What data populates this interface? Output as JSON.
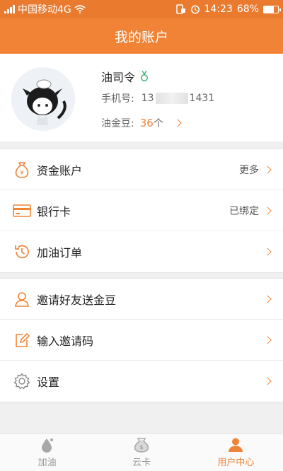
{
  "status_bar": {
    "carrier": "中国移动4G",
    "time": "14:23",
    "battery": "68%",
    "battery_level": 0.68
  },
  "header": {
    "title": "我的账户"
  },
  "profile": {
    "name": "油司令",
    "phone_label": "手机号:",
    "phone_prefix": "13",
    "phone_suffix": "1431",
    "beans_label": "油金豆:",
    "beans_count": "36",
    "beans_unit": "个"
  },
  "menu_group_1": [
    {
      "label": "资金账户",
      "value": "更多",
      "icon": "money-bag-icon"
    },
    {
      "label": "银行卡",
      "value": "已绑定",
      "icon": "bank-card-icon"
    },
    {
      "label": "加油订单",
      "value": "",
      "icon": "history-clock-icon"
    }
  ],
  "menu_group_2": [
    {
      "label": "邀请好友送金豆",
      "value": "",
      "icon": "person-icon"
    },
    {
      "label": "输入邀请码",
      "value": "",
      "icon": "edit-icon"
    },
    {
      "label": "设置",
      "value": "",
      "icon": "gear-icon"
    }
  ],
  "tabbar": [
    {
      "label": "加油",
      "icon": "fuel-drop-icon",
      "active": false
    },
    {
      "label": "云卡",
      "icon": "cloud-card-icon",
      "active": false
    },
    {
      "label": "用户中心",
      "icon": "user-icon",
      "active": true
    }
  ],
  "colors": {
    "accent": "#f08335",
    "status_bar": "#e97a2e",
    "background": "#f0f0f0"
  }
}
